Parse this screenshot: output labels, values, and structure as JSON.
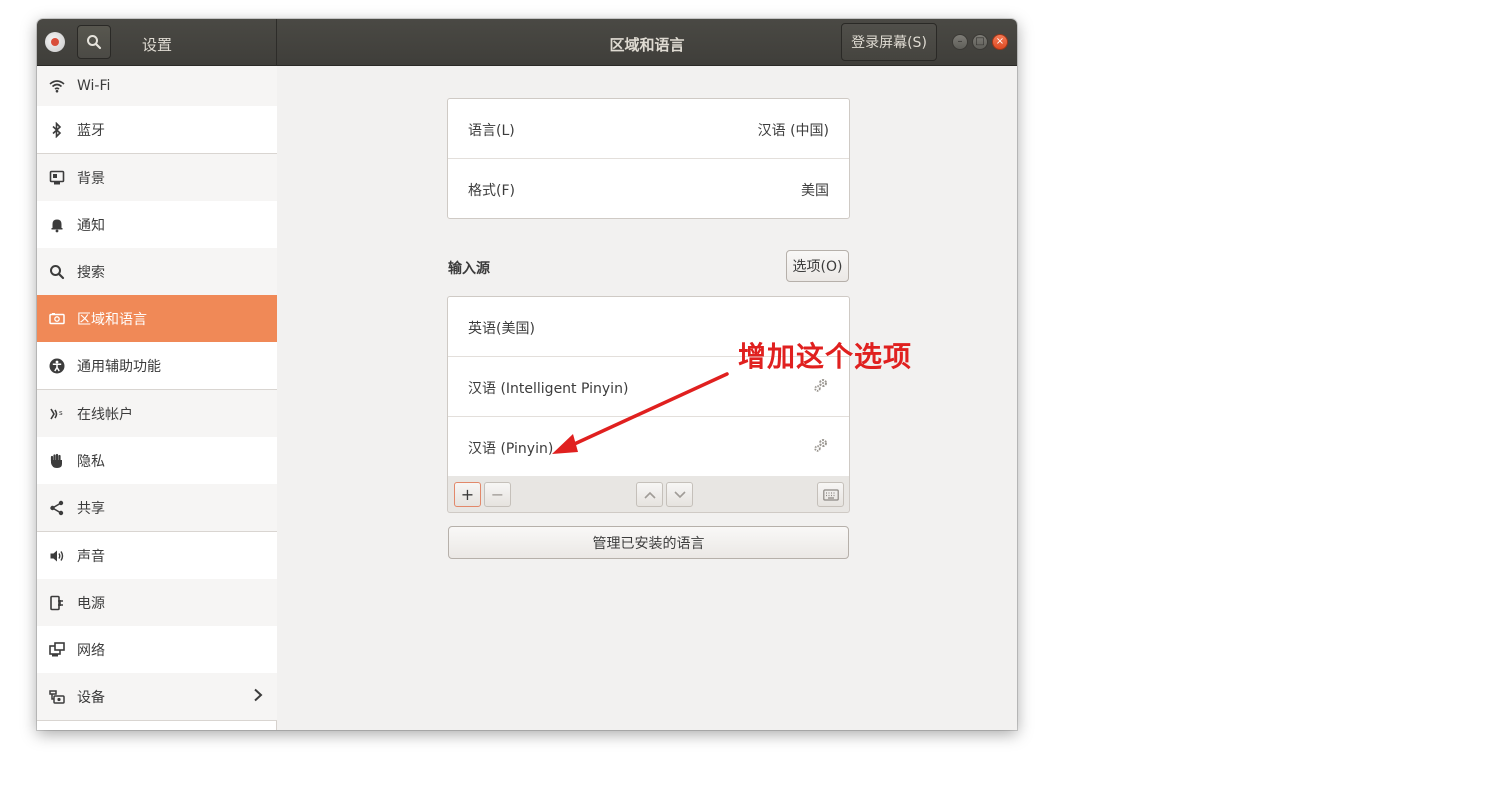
{
  "header": {
    "sidebar_title": "设置",
    "title": "区域和语言",
    "login_screen_label": "登录屏幕(S)",
    "window_buttons": [
      "–",
      "□",
      "×"
    ]
  },
  "sidebar": {
    "items": [
      {
        "label": "Wi-Fi",
        "icon": "wifi-icon"
      },
      {
        "label": "蓝牙",
        "icon": "bluetooth-icon"
      },
      {
        "label": "背景",
        "icon": "background-icon"
      },
      {
        "label": "通知",
        "icon": "bell-icon"
      },
      {
        "label": "搜索",
        "icon": "search-icon"
      },
      {
        "label": "区域和语言",
        "icon": "region-icon",
        "active": true
      },
      {
        "label": "通用辅助功能",
        "icon": "accessibility-icon"
      },
      {
        "label": "在线帐户",
        "icon": "online-accounts-icon"
      },
      {
        "label": "隐私",
        "icon": "hand-icon"
      },
      {
        "label": "共享",
        "icon": "share-icon"
      },
      {
        "label": "声音",
        "icon": "speaker-icon"
      },
      {
        "label": "电源",
        "icon": "power-icon"
      },
      {
        "label": "网络",
        "icon": "network-icon"
      },
      {
        "label": "设备",
        "icon": "devices-icon"
      }
    ]
  },
  "language_card": {
    "rows": [
      {
        "label": "语言(L)",
        "value": "汉语 (中国)"
      },
      {
        "label": "格式(F)",
        "value": "美国"
      }
    ]
  },
  "input_sources": {
    "title": "输入源",
    "options_label": "选项(O)",
    "items": [
      {
        "label": "英语(美国)"
      },
      {
        "label": "汉语 (Intelligent Pinyin)",
        "icon": "gear-icon"
      },
      {
        "label": "汉语 (Pinyin)",
        "icon": "gear-icon"
      }
    ],
    "toolbar": {
      "add": "+",
      "remove": "−"
    }
  },
  "manage_languages_label": "管理已安装的语言",
  "annotation": {
    "text": "增加这个选项",
    "color": "#e0201f"
  },
  "colors": {
    "accent": "#f08957",
    "headerbar": "#45443f"
  }
}
